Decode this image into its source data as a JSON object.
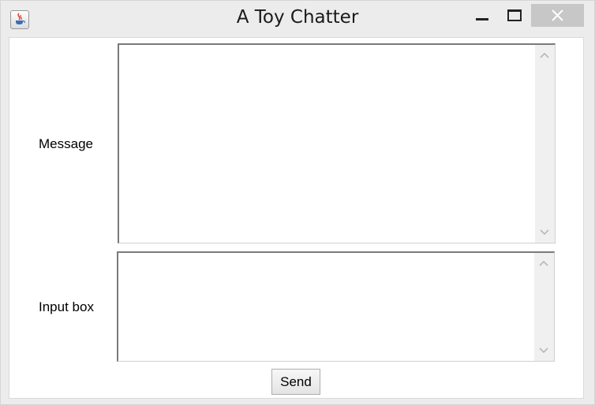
{
  "window": {
    "title": "A Toy Chatter",
    "icon": "java-cup-icon",
    "controls": [
      "minimize-icon",
      "maximize-icon",
      "close-icon"
    ],
    "close_hover_color": "#c7c7c7"
  },
  "form": {
    "message_label": "Message",
    "message_value": "",
    "input_label": "Input box",
    "input_value": "",
    "send_label": "Send"
  }
}
